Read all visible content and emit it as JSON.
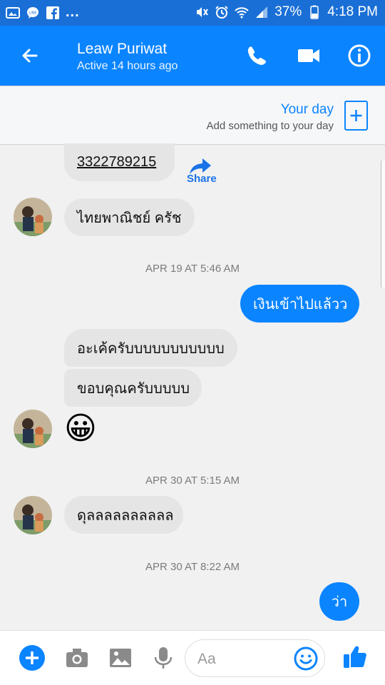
{
  "status": {
    "battery": "37%",
    "time": "4:18 PM",
    "icons": [
      "gallery-icon",
      "line-icon",
      "facebook-icon",
      "more-dots",
      "mute-icon",
      "alarm-icon",
      "wifi-icon",
      "signal-icon",
      "battery-icon"
    ]
  },
  "header": {
    "title": "Leaw Puriwat",
    "subtitle": "Active 14 hours ago",
    "back_icon": "arrow-left-icon",
    "call_icon": "phone-icon",
    "video_icon": "video-camera-icon",
    "info_icon": "info-icon"
  },
  "your_day": {
    "title": "Your day",
    "subtitle": "Add something to your day"
  },
  "messages": {
    "number_link": "3322789215",
    "share_label": "Share",
    "bank": "ไทยพาณิชย์ ครัช",
    "t1": "APR 19 AT 5:46 AM",
    "out1": "เงินเข้าไปแล้วว",
    "in1": "อะเค้ครับบบบบบบบบบบ",
    "in2": "ขอบคุณครับบบบบ",
    "emoji": "😀",
    "t2": "APR 30 AT 5:15 AM",
    "in3": "ดุลลลลลลลลลล",
    "t3": "APR 30 AT 8:22 AM",
    "out2": "ว่า"
  },
  "composer": {
    "placeholder": "Aa",
    "plus_icon": "plus-icon",
    "camera_icon": "camera-icon",
    "image_icon": "image-icon",
    "mic_icon": "microphone-icon",
    "emoji_icon": "smiley-icon",
    "like_icon": "thumbs-up-icon"
  }
}
